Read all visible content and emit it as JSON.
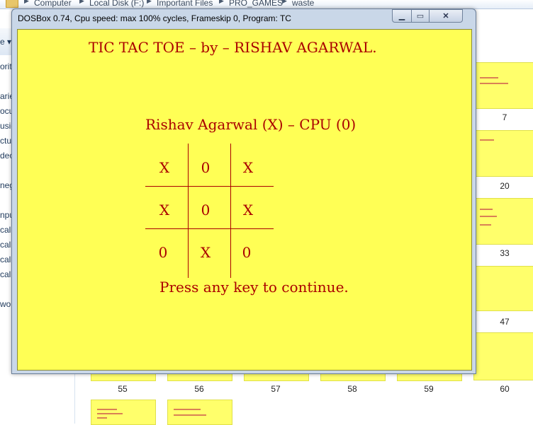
{
  "explorer": {
    "breadcrumb": [
      "Computer",
      "Local Disk (F:)",
      "Important Files",
      "PRO_GAMES",
      "waste"
    ],
    "nav_items": [
      "orit",
      "arie",
      "ocu",
      "usic",
      "ctu",
      "dec",
      "neg",
      "npu",
      "cal",
      "cal",
      "cal",
      "cal",
      "wor"
    ],
    "thumb_labels": [
      "7",
      "20",
      "33",
      "47",
      "55",
      "56",
      "57",
      "58",
      "59",
      "60"
    ]
  },
  "window": {
    "title": "DOSBox 0.74, Cpu speed: max 100% cycles, Frameskip  0, Program:      TC",
    "min_icon": "minimize-icon",
    "max_icon": "maximize-icon",
    "close_icon": "close-icon",
    "min_glyph": "▁",
    "max_glyph": "▭",
    "close_glyph": "✕"
  },
  "game": {
    "header": "TIC TAC TOE – by – RISHAV AGARWAL.",
    "players": "Rishav Agarwal (X)  –   CPU (0)",
    "board": [
      [
        "X",
        "0",
        "X"
      ],
      [
        "X",
        "0",
        "X"
      ],
      [
        "0",
        "X",
        "0"
      ]
    ],
    "prompt": "Press any key to continue.",
    "colors": {
      "background": "#ffff55",
      "text": "#aa0000"
    }
  }
}
